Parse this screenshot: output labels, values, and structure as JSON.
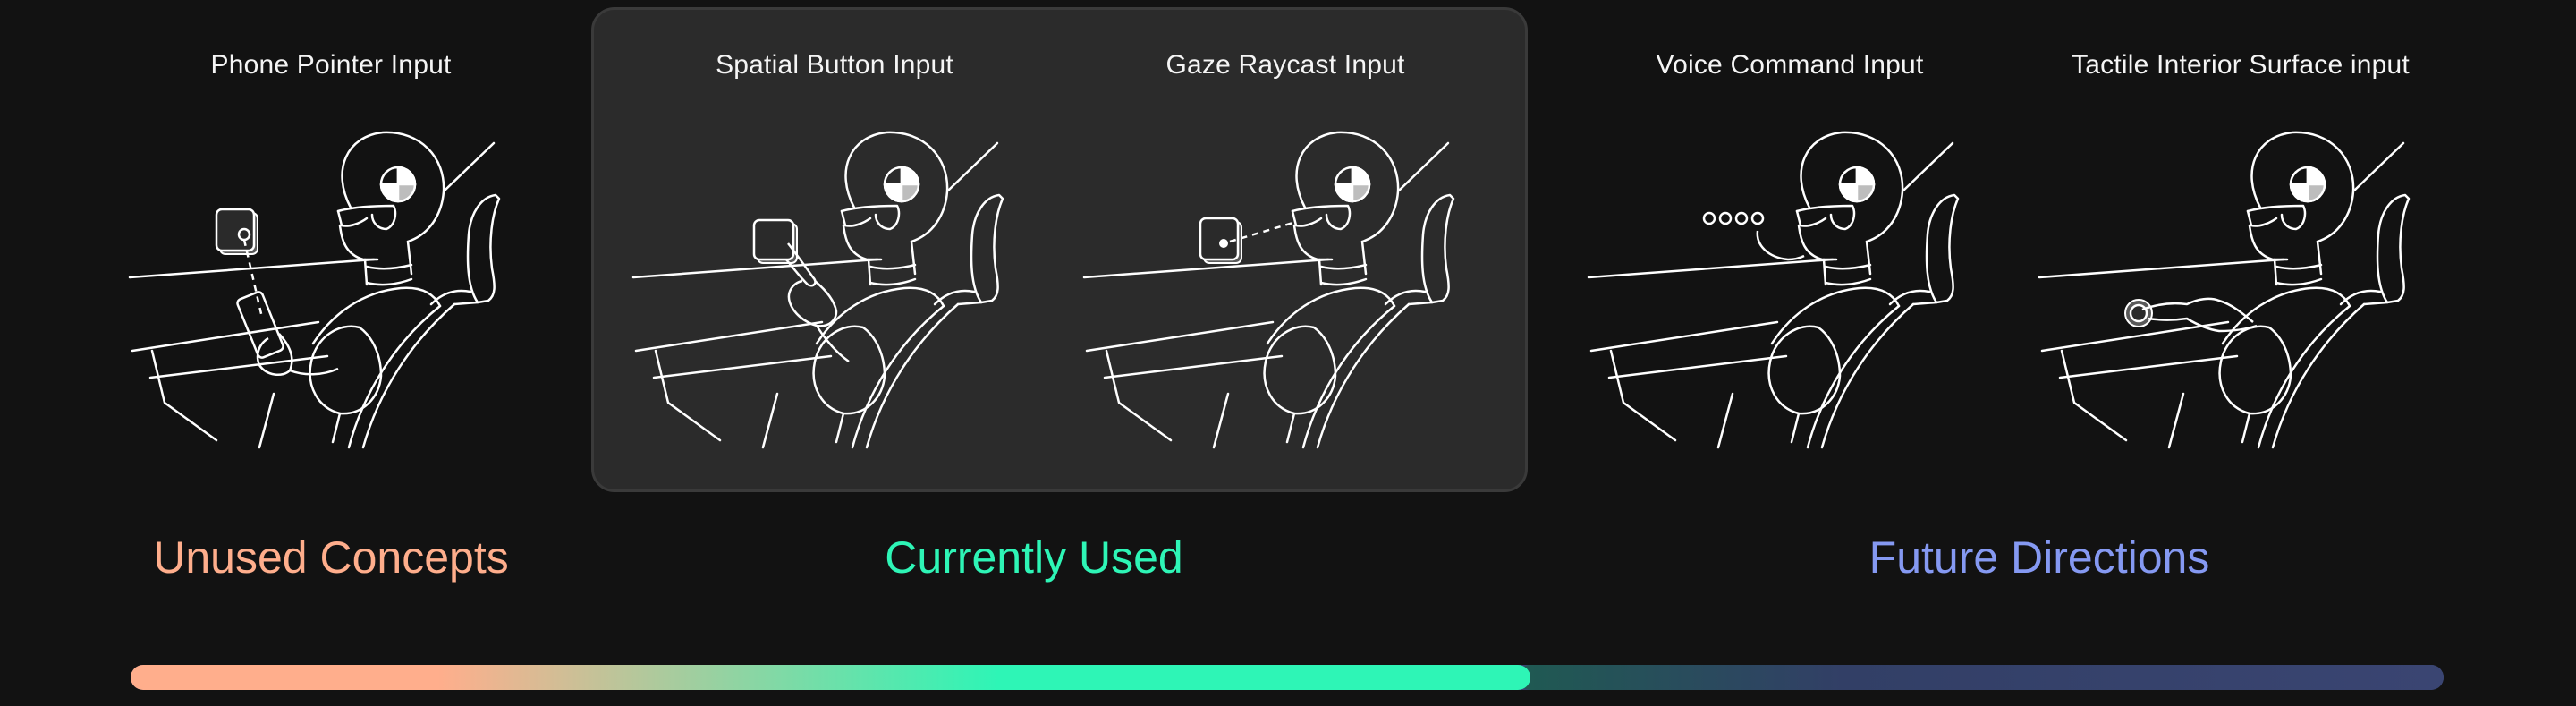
{
  "panels": [
    {
      "id": "phone",
      "title": "Phone Pointer Input",
      "icon": "phone-pointer-illustration"
    },
    {
      "id": "spatial",
      "title": "Spatial Button Input",
      "icon": "spatial-button-illustration"
    },
    {
      "id": "gaze",
      "title": "Gaze Raycast Input",
      "icon": "gaze-raycast-illustration"
    },
    {
      "id": "voice",
      "title": "Voice Command Input",
      "icon": "voice-command-illustration"
    },
    {
      "id": "tactile",
      "title": "Tactile Interior Surface input",
      "icon": "tactile-surface-illustration"
    }
  ],
  "categories": {
    "unused": "Unused Concepts",
    "current": "Currently Used",
    "future": "Future Directions"
  },
  "colors": {
    "background": "#121212",
    "highlight_box": "#2b2b2b",
    "unused": "#ffae8c",
    "current": "#2ef5b6",
    "future": "#8599f2",
    "future_bar": "#3a4572",
    "line_art": "#ffffff"
  },
  "progress": {
    "filled_fraction": 0.605
  }
}
